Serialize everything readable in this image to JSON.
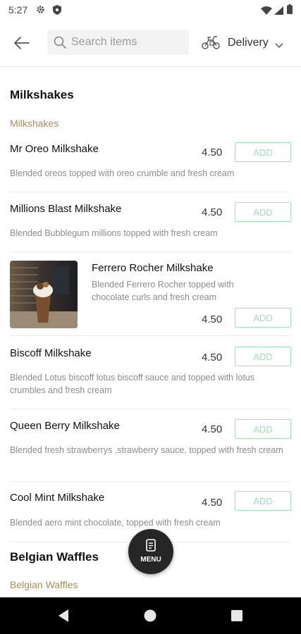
{
  "status_bar": {
    "time": "5:27"
  },
  "header": {
    "search_placeholder": "Search items",
    "delivery_label": "Delivery"
  },
  "sections": [
    {
      "title": "Milkshakes",
      "subcategory": "Milkshakes"
    },
    {
      "title": "Belgian Waffles",
      "subcategory": "Belgian Waffles"
    }
  ],
  "items": [
    {
      "name": "Mr Oreo Milkshake",
      "price": "4.50",
      "add_label": "ADD",
      "description": "Blended oreos topped with oreo crumble and fresh cream"
    },
    {
      "name": "Millions Blast Milkshake",
      "price": "4.50",
      "add_label": "ADD",
      "description": "Blended Bubblegum millions topped with fresh cream"
    },
    {
      "name": "Ferrero Rocher Milkshake",
      "price": "4.50",
      "add_label": "ADD",
      "description": "Blended Ferrero Rocher topped with chocolate curls and fresh cream"
    },
    {
      "name": "Biscoff Milkshake",
      "price": "4.50",
      "add_label": "ADD",
      "description": "Blended Lotus biscoff lotus biscoff sauce and topped with lotus crumbles and fresh cream"
    },
    {
      "name": "Queen Berry Milkshake",
      "price": "4.50",
      "add_label": "ADD",
      "description": "Blended fresh strawberrys ,strawberry sauce, topped with fresh cream"
    },
    {
      "name": "Cool Mint Milkshake",
      "price": "4.50",
      "add_label": "ADD",
      "description": "Blended aero mint chocolate, topped with fresh cream"
    }
  ],
  "fab": {
    "label": "MENU"
  },
  "colors": {
    "accent_green": "#9ce0b4",
    "subcategory_gold": "#a88d5c"
  },
  "icons": [
    "settings-icon",
    "shield-icon",
    "wifi-icon",
    "signal-icon",
    "battery-icon",
    "back-arrow-icon",
    "search-icon",
    "bike-icon",
    "chevron-down-icon",
    "menu-doc-icon",
    "nav-back-icon",
    "nav-home-icon",
    "nav-recents-icon"
  ]
}
